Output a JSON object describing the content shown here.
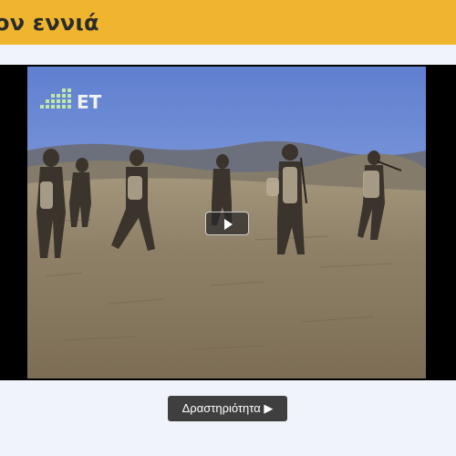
{
  "header": {
    "title": "ον εννιά"
  },
  "video": {
    "channel_logo": "ΕΤ",
    "play_button_icon": "play-icon"
  },
  "actions": {
    "activity_label": "Δραστηριότητα ▶"
  },
  "colors": {
    "header_bg": "#efb52f",
    "page_bg": "#f1f3fa",
    "button_bg": "#3f3f3f"
  }
}
